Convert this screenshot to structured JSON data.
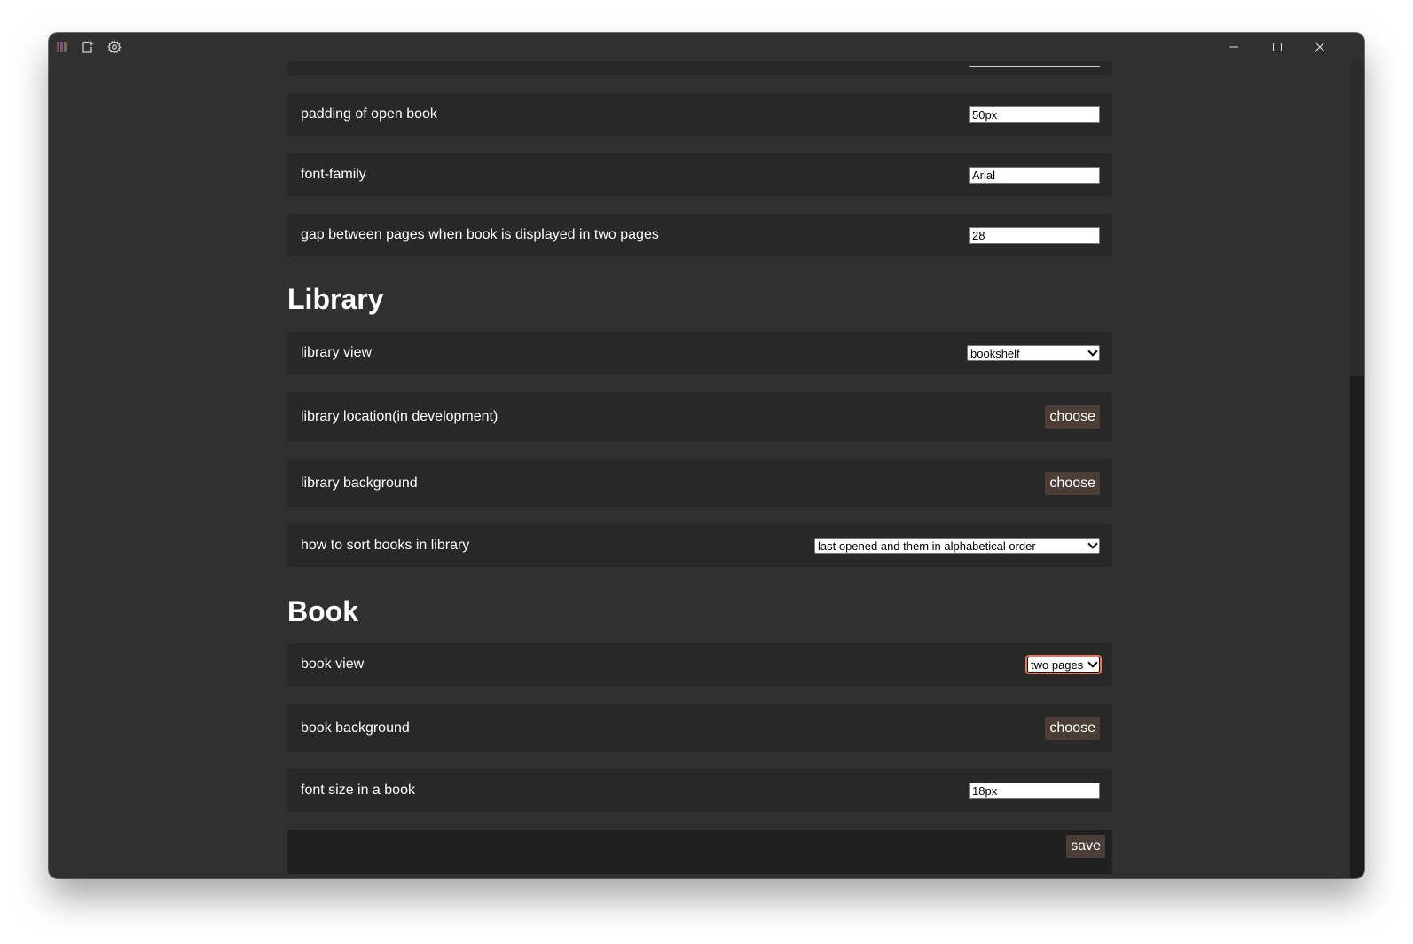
{
  "titlebar": {
    "icons": [
      "library-icon",
      "add-book-icon",
      "settings-gear-icon"
    ],
    "window_controls": [
      "minimize-icon",
      "maximize-icon",
      "close-icon"
    ]
  },
  "display": {
    "rows": [
      {
        "label": "padding of open book",
        "value": "50px"
      },
      {
        "label": "font-family",
        "value": "Arial"
      },
      {
        "label": "gap between pages when book is displayed in two pages",
        "value": "28"
      }
    ]
  },
  "library": {
    "heading": "Library",
    "view_label": "library view",
    "view_value": "bookshelf",
    "location_label": "library location(in development)",
    "location_button": "choose",
    "background_label": "library background",
    "background_button": "choose",
    "sort_label": "how to sort books in library",
    "sort_value": "last opened and them in alphabetical order"
  },
  "book": {
    "heading": "Book",
    "view_label": "book view",
    "view_value": "two pages",
    "background_label": "book background",
    "background_button": "choose",
    "font_size_label": "font size in a book",
    "font_size_value": "18px"
  },
  "footer": {
    "save_label": "save"
  },
  "colors": {
    "window_bg": "#303030",
    "row_bg": "#282828",
    "button_bg": "#4a3e36",
    "footer_bg": "#202020",
    "focus_ring": "#e07a5f"
  }
}
